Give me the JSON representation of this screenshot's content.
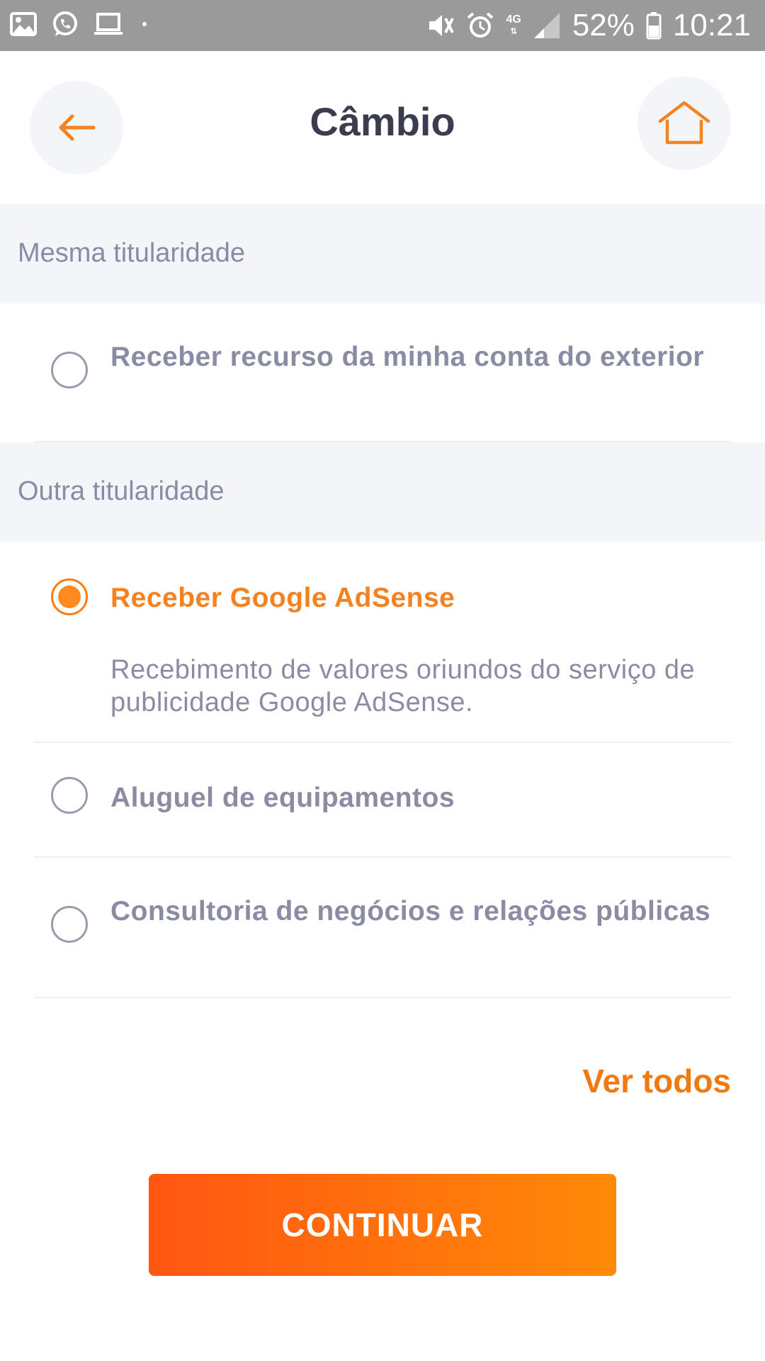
{
  "status_bar": {
    "signal_label": "4G",
    "battery": "52%",
    "time": "10:21",
    "icons_left": [
      "image-icon",
      "whatsapp-icon",
      "laptop-icon",
      "dot-icon"
    ],
    "icons_right": [
      "vibrate-mute-icon",
      "alarm-icon",
      "network-4g-icon",
      "signal-icon",
      "battery-icon"
    ]
  },
  "header": {
    "title": "Câmbio",
    "back_icon": "arrow-left-icon",
    "home_icon": "home-icon"
  },
  "sections": [
    {
      "title": "Mesma titularidade",
      "options": [
        {
          "label": "Receber recurso da minha conta do exterior",
          "selected": false
        }
      ]
    },
    {
      "title": "Outra titularidade",
      "options": [
        {
          "label": "Receber Google AdSense",
          "selected": true,
          "description": "Recebimento de valores oriundos do serviço de publicidade Google AdSense."
        },
        {
          "label": "Aluguel de equipamentos",
          "selected": false
        },
        {
          "label": "Consultoria de negócios e relações públicas",
          "selected": false
        }
      ]
    }
  ],
  "actions": {
    "see_all": "Ver todos",
    "continue": "CONTINUAR"
  },
  "colors": {
    "accent": "#f58220",
    "button_gradient_start": "#ff5612",
    "button_gradient_end": "#ff8a08",
    "section_background": "#f4f5f9",
    "muted_text": "#8a8ca3",
    "title_text": "#3b3d4f"
  }
}
